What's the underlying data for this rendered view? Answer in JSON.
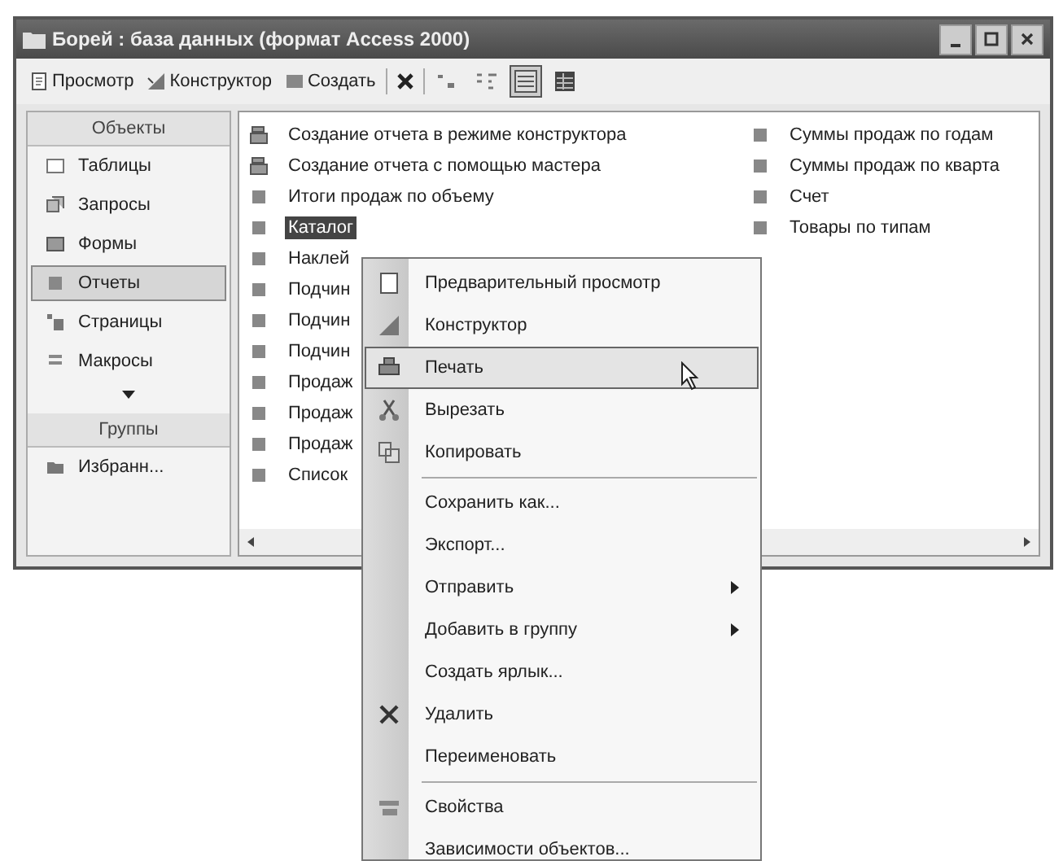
{
  "window": {
    "title": "Борей : база данных (формат Access 2000)"
  },
  "toolbar": {
    "buttons": [
      {
        "label": "Просмотр",
        "kind": "preview"
      },
      {
        "label": "Конструктор",
        "kind": "design"
      },
      {
        "label": "Создать",
        "kind": "new"
      }
    ],
    "view_buttons": [
      {
        "kind": "large-icons",
        "selected": false
      },
      {
        "kind": "small-icons",
        "selected": false
      },
      {
        "kind": "list",
        "selected": true
      },
      {
        "kind": "details",
        "selected": false
      }
    ]
  },
  "sidebar": {
    "objects_header": "Объекты",
    "items": [
      {
        "label": "Таблицы",
        "kind": "table",
        "selected": false
      },
      {
        "label": "Запросы",
        "kind": "query",
        "selected": false
      },
      {
        "label": "Формы",
        "kind": "form",
        "selected": false
      },
      {
        "label": "Отчеты",
        "kind": "report",
        "selected": true
      },
      {
        "label": "Страницы",
        "kind": "page",
        "selected": false
      },
      {
        "label": "Макросы",
        "kind": "macro",
        "selected": false
      }
    ],
    "groups_header": "Группы",
    "groups": [
      {
        "label": "Избранн..."
      }
    ]
  },
  "list": {
    "columns": [
      [
        {
          "label": "Создание отчета в режиме конструктора",
          "kind": "wizard",
          "selected": false
        },
        {
          "label": "Создание отчета с помощью мастера",
          "kind": "wizard",
          "selected": false
        },
        {
          "label": "Итоги продаж по объему",
          "kind": "report",
          "selected": false
        },
        {
          "label": "Каталог",
          "kind": "report",
          "selected": true
        },
        {
          "label": "Наклей",
          "kind": "report",
          "selected": false
        },
        {
          "label": "Подчин",
          "kind": "report",
          "selected": false
        },
        {
          "label": "Подчин",
          "kind": "report",
          "selected": false
        },
        {
          "label": "Подчин",
          "kind": "report",
          "selected": false
        },
        {
          "label": "Продаж",
          "kind": "report",
          "selected": false
        },
        {
          "label": "Продаж",
          "kind": "report",
          "selected": false
        },
        {
          "label": "Продаж",
          "kind": "report",
          "selected": false
        },
        {
          "label": "Список",
          "kind": "report",
          "selected": false
        }
      ],
      [
        {
          "label": "Суммы продаж по годам",
          "kind": "report",
          "selected": false
        },
        {
          "label": "Суммы продаж по кварта",
          "kind": "report",
          "selected": false
        },
        {
          "label": "Счет",
          "kind": "report",
          "selected": false
        },
        {
          "label": "Товары по типам",
          "kind": "report",
          "selected": false
        }
      ]
    ]
  },
  "context_menu": {
    "items": [
      {
        "label": "Предварительный просмотр",
        "kind": "preview",
        "selected": false
      },
      {
        "label": "Конструктор",
        "kind": "design",
        "selected": false
      },
      {
        "label": "Печать",
        "kind": "print",
        "selected": true
      },
      {
        "label": "Вырезать",
        "kind": "cut",
        "selected": false
      },
      {
        "label": "Копировать",
        "kind": "copy",
        "selected": false
      },
      {
        "kind": "separator"
      },
      {
        "label": "Сохранить как...",
        "kind": "plain",
        "selected": false
      },
      {
        "label": "Экспорт...",
        "kind": "plain",
        "selected": false
      },
      {
        "label": "Отправить",
        "kind": "submenu",
        "selected": false
      },
      {
        "label": "Добавить в группу",
        "kind": "submenu",
        "selected": false
      },
      {
        "label": "Создать ярлык...",
        "kind": "plain",
        "selected": false
      },
      {
        "label": "Удалить",
        "kind": "delete",
        "selected": false
      },
      {
        "label": "Переименовать",
        "kind": "plain",
        "selected": false
      },
      {
        "kind": "separator"
      },
      {
        "label": "Свойства",
        "kind": "properties",
        "selected": false
      },
      {
        "label": "Зависимости объектов...",
        "kind": "plain",
        "selected": false
      }
    ]
  }
}
